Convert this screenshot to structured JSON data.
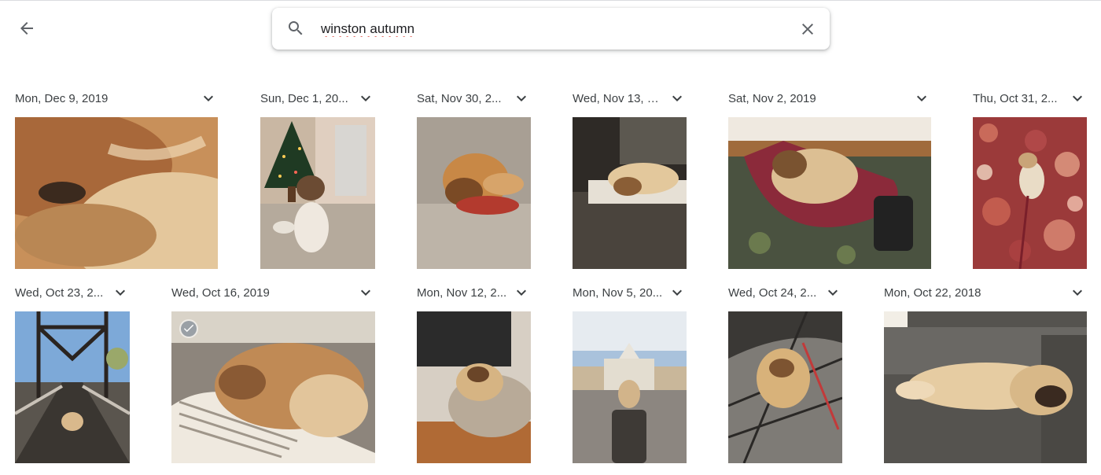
{
  "search": {
    "query": "winston autumn"
  },
  "icons": {
    "back": "arrow-back-icon",
    "search": "search-icon",
    "clear": "close-icon",
    "expand": "chevron-down-icon",
    "select": "check-circle-icon"
  },
  "colors": {
    "text": "#3c4043",
    "icon": "#5f6368",
    "spellcheck": "#d93025"
  },
  "groups": [
    {
      "date": "Mon, Dec 9, 2019"
    },
    {
      "date": "Sun, Dec 1, 20..."
    },
    {
      "date": "Sat, Nov 30, 2..."
    },
    {
      "date": "Wed, Nov 13, 2..."
    },
    {
      "date": "Sat, Nov 2, 2019"
    },
    {
      "date": "Thu, Oct 31, 2..."
    },
    {
      "date": "Wed, Oct 23, 2..."
    },
    {
      "date": "Wed, Oct 16, 2019"
    },
    {
      "date": "Mon, Nov 12, 2..."
    },
    {
      "date": "Mon, Nov 5, 20..."
    },
    {
      "date": "Wed, Oct 24, 2..."
    },
    {
      "date": "Mon, Oct 22, 2018"
    }
  ]
}
